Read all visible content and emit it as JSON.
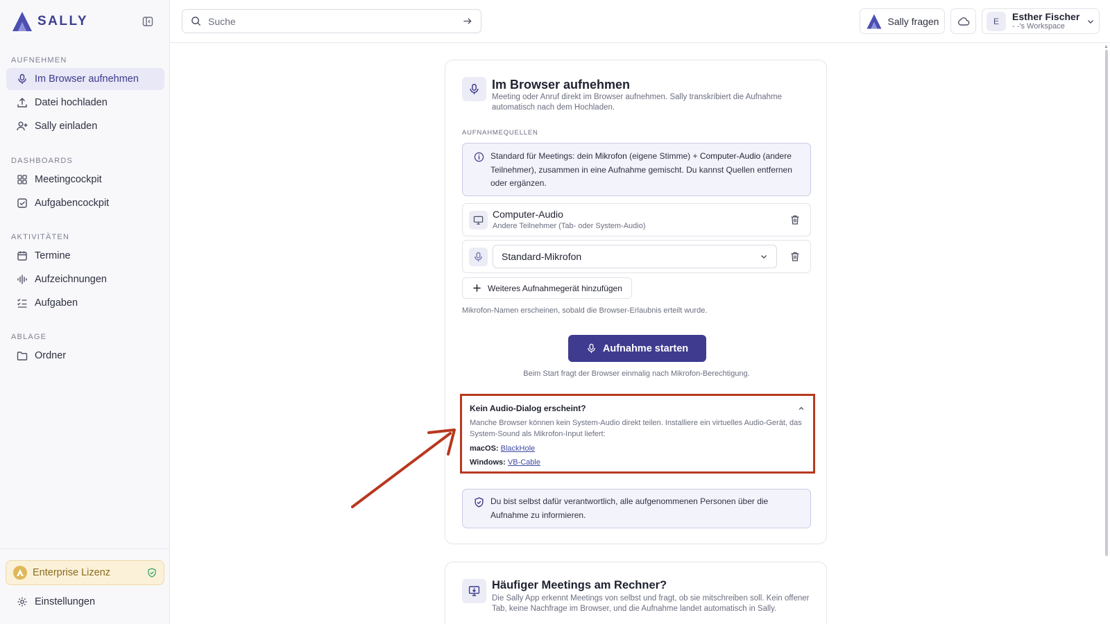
{
  "brand": {
    "name": "SALLY"
  },
  "sidebar": {
    "sections": [
      {
        "label": "AUFNEHMEN",
        "items": [
          {
            "label": "Im Browser aufnehmen",
            "icon": "mic-icon",
            "active": true
          },
          {
            "label": "Datei hochladen",
            "icon": "upload-icon"
          },
          {
            "label": "Sally einladen",
            "icon": "user-plus-icon"
          }
        ]
      },
      {
        "label": "DASHBOARDS",
        "items": [
          {
            "label": "Meetingcockpit",
            "icon": "grid-icon"
          },
          {
            "label": "Aufgabencockpit",
            "icon": "check-square-icon"
          }
        ]
      },
      {
        "label": "AKTIVITÄTEN",
        "items": [
          {
            "label": "Termine",
            "icon": "calendar-icon"
          },
          {
            "label": "Aufzeichnungen",
            "icon": "audio-lines-icon"
          },
          {
            "label": "Aufgaben",
            "icon": "list-checks-icon"
          }
        ]
      },
      {
        "label": "ABLAGE",
        "items": [
          {
            "label": "Ordner",
            "icon": "folder-icon"
          }
        ]
      }
    ],
    "license": "Enterprise Lizenz",
    "settings": "Einstellungen"
  },
  "topbar": {
    "search_placeholder": "Suche",
    "ask_label": "Sally fragen",
    "user": {
      "initial": "E",
      "name": "Esther Fischer",
      "workspace": "- -'s Workspace"
    }
  },
  "record": {
    "title": "Im Browser aufnehmen",
    "description": "Meeting oder Anruf direkt im Browser aufnehmen. Sally transkribiert die Aufnahme automatisch nach dem Hochladen.",
    "sources_label": "AUFNAHMEQUELLEN",
    "info": {
      "p1": "Standard für Meetings: dein ",
      "b1": "Mikrofon",
      "p2": " (eigene Stimme) + ",
      "b2": "Computer-Audio",
      "p3": " (andere Teilnehmer), zusammen in eine Aufnahme gemischt. Du kannst Quellen entfernen oder ergänzen."
    },
    "computer_audio": {
      "title": "Computer-Audio",
      "subtitle": "Andere Teilnehmer (Tab- oder System-Audio)"
    },
    "microphone": {
      "selected": "Standard-Mikrofon"
    },
    "add_device": "Weiteres Aufnahmegerät hinzufügen",
    "mic_hint": "Mikrofon-Namen erscheinen, sobald die Browser-Erlaubnis erteilt wurde.",
    "start_button": "Aufnahme starten",
    "start_hint": "Beim Start fragt der Browser einmalig nach Mikrofon-Berechtigung.",
    "help": {
      "title": "Kein Audio-Dialog erscheint?",
      "description": "Manche Browser können kein System-Audio direkt teilen. Installiere ein virtuelles Audio-Gerät, das System-Sound als Mikrofon-Input liefert:",
      "mac_label": "macOS:",
      "mac_link": "BlackHole",
      "win_label": "Windows:",
      "win_link": "VB-Cable"
    },
    "consent": "Du bist selbst dafür verantwortlich, alle aufgenommenen Personen über die Aufnahme zu informieren."
  },
  "app_promo": {
    "title": "Häufiger Meetings am Rechner?",
    "description": "Die Sally App erkennt Meetings von selbst und fragt, ob sie mitschreiben soll. Kein offener Tab, keine Nachfrage im Browser, und die Aufnahme landet automatisch in Sally."
  },
  "colors": {
    "accent": "#3f3b8f",
    "highlight": "#b7391e",
    "license_bg": "#fbf1d9"
  }
}
